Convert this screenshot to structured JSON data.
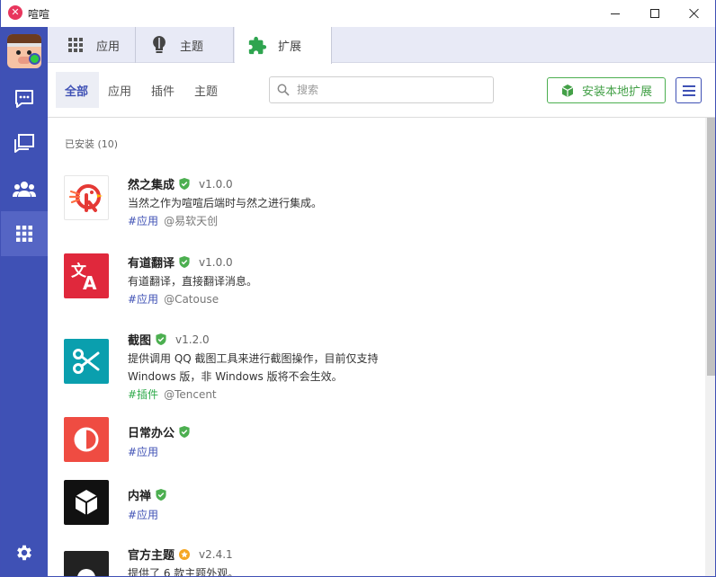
{
  "window": {
    "title": "喧喧",
    "logo_glyph": "✕"
  },
  "sidebar": {
    "status_color": "#2ecc40",
    "items": [
      {
        "name": "chat",
        "icon": "chat-bubble-icon",
        "active": false
      },
      {
        "name": "groups",
        "icon": "group-chat-icon",
        "active": false
      },
      {
        "name": "contacts",
        "icon": "contacts-icon",
        "active": false
      },
      {
        "name": "apps",
        "icon": "grid-icon",
        "active": true
      },
      {
        "name": "settings",
        "icon": "gear-icon",
        "active": false
      }
    ]
  },
  "tabs": [
    {
      "label": "应用",
      "icon": "grid-icon",
      "active": false
    },
    {
      "label": "主题",
      "icon": "lightbulb-icon",
      "active": false
    },
    {
      "label": "扩展",
      "icon": "puzzle-icon",
      "active": true
    }
  ],
  "filters": {
    "all": "全部",
    "apps": "应用",
    "plugins": "插件",
    "themes": "主题",
    "active": "all"
  },
  "search": {
    "placeholder": "搜索",
    "value": ""
  },
  "toolbar": {
    "install_label": "安装本地扩展"
  },
  "list": {
    "section_title": "已安装 (10)",
    "items": [
      {
        "name": "然之集成",
        "badge": "verified",
        "version": "v1.0.0",
        "desc": "当然之作为喧喧后端时与然之进行集成。",
        "tag": "#应用",
        "author": "@易软天创",
        "icon": "ranzhi-logo-icon"
      },
      {
        "name": "有道翻译",
        "badge": "verified",
        "version": "v1.0.0",
        "desc": "有道翻译，直接翻译消息。",
        "tag": "#应用",
        "author": "@Catouse",
        "icon": "translate-icon"
      },
      {
        "name": "截图",
        "badge": "verified",
        "version": "v1.2.0",
        "desc": "提供调用 QQ 截图工具来进行截图操作，目前仅支持 Windows 版，非 Windows 版将不会生效。",
        "tag": "#插件",
        "author": "@Tencent",
        "icon": "scissors-icon"
      },
      {
        "name": "日常办公",
        "badge": "verified",
        "version": "",
        "desc": "",
        "tag": "#应用",
        "author": "",
        "icon": "half-circle-icon"
      },
      {
        "name": "内禅",
        "badge": "verified",
        "version": "",
        "desc": "",
        "tag": "#应用",
        "author": "",
        "icon": "cube-icon"
      },
      {
        "name": "官方主题",
        "badge": "official",
        "version": "v2.4.1",
        "desc": "提供了 6 款主题外观。",
        "tag": "",
        "author": "",
        "icon": "theme-circle-icon"
      }
    ]
  },
  "colors": {
    "sidebar": "#3f51b5",
    "accent": "#3f51b5",
    "install_green": "#43a047",
    "verified_green": "#4caf50",
    "official_orange": "#f5a623"
  }
}
